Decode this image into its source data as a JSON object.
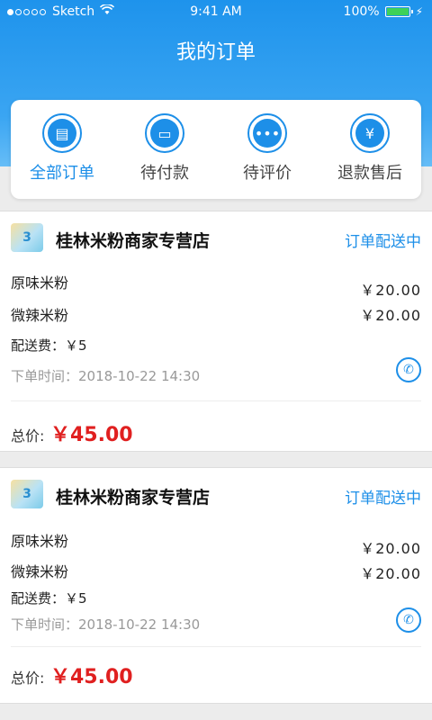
{
  "statusbar": {
    "carrier": "Sketch",
    "time": "9:41 AM",
    "battery": "100%"
  },
  "page_title": "我的订单",
  "tabs": [
    {
      "label": "全部订单",
      "icon": "order-doc-icon",
      "active": true
    },
    {
      "label": "待付款",
      "icon": "wallet-icon",
      "active": false
    },
    {
      "label": "待评价",
      "icon": "chat-bubble-icon",
      "active": false
    },
    {
      "label": "退款售后",
      "icon": "refund-icon",
      "active": false
    }
  ],
  "orders": [
    {
      "shop": "桂林米粉商家专营店",
      "status": "订单配送中",
      "items": [
        {
          "name": "原味米粉",
          "price": "￥20.00"
        },
        {
          "name": "微辣米粉",
          "price": "￥20.00"
        }
      ],
      "fee": "配送费：￥5",
      "time": "下单时间：2018-10-22  14:30",
      "total_label": "总价:",
      "total": "￥45.00"
    },
    {
      "shop": "桂林米粉商家专营店",
      "status": "订单配送中",
      "items": [
        {
          "name": "原味米粉",
          "price": "￥20.00"
        },
        {
          "name": "微辣米粉",
          "price": "￥20.00"
        }
      ],
      "fee": "配送费：￥5",
      "time": "下单时间：2018-10-22  14:30",
      "total_label": "总价:",
      "total": "￥45.00"
    }
  ],
  "colors": {
    "accent": "#1d8fe8",
    "price": "#e02020"
  }
}
